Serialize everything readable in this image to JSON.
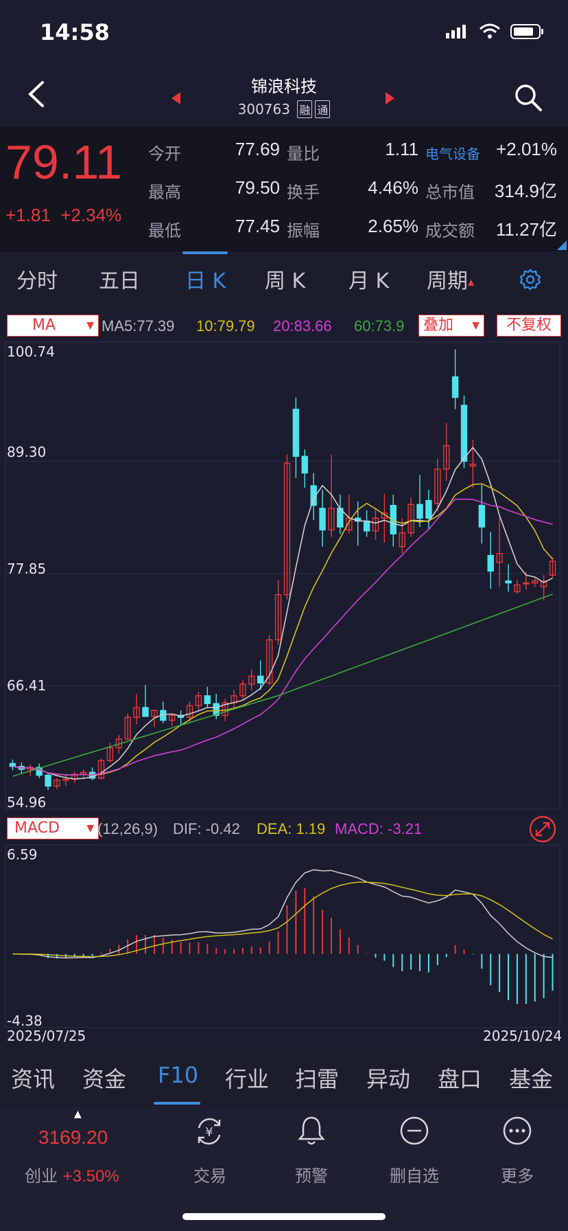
{
  "status": {
    "time": "14:58"
  },
  "header": {
    "title": "锦浪科技",
    "code": "300763",
    "badge1": "融",
    "badge2": "通"
  },
  "quote": {
    "price": "79.11",
    "change": "+1.81",
    "change_pct": "+2.34%",
    "rows": [
      {
        "k1": "今开",
        "v1": "77.69",
        "k2": "量比",
        "v2": "1.11",
        "k3": "电气设备",
        "v3": "+2.01%"
      },
      {
        "k1": "最高",
        "v1": "79.50",
        "k2": "换手",
        "v2": "4.46%",
        "k3": "总市值",
        "v3": "314.9亿"
      },
      {
        "k1": "最低",
        "v1": "77.45",
        "k2": "振幅",
        "v2": "2.65%",
        "k3": "成交额",
        "v3": "11.27亿"
      }
    ]
  },
  "tabs": [
    "分时",
    "五日",
    "日 K",
    "周 K",
    "月 K",
    "周期"
  ],
  "active_tab": "日 K",
  "ma_bar": {
    "selector": "MA",
    "ma5": "MA5:77.39",
    "ma10": "10:79.79",
    "ma20": "20:83.66",
    "ma60": "60:73.9",
    "overlay": "叠加",
    "adjust": "不复权"
  },
  "price_axis": [
    "100.74",
    "89.30",
    "77.85",
    "66.41",
    "54.96"
  ],
  "macd_bar": {
    "selector": "MACD",
    "params": "(12,26,9)",
    "dif": "DIF: -0.42",
    "dea": "DEA: 1.19",
    "macd": "MACD: -3.21"
  },
  "macd_axis": [
    "6.59",
    "-4.38"
  ],
  "dates": {
    "start": "2025/07/25",
    "end": "2025/10/24"
  },
  "bottom_tabs": [
    "资讯",
    "资金",
    "F10",
    "行业",
    "扫雷",
    "异动",
    "盘口",
    "基金"
  ],
  "active_bottom_tab": "F10",
  "nav": {
    "index_value": "3169.20",
    "index_name": "创业",
    "index_pct": "+3.50%",
    "items": [
      {
        "label": "交易",
        "icon": "yen-exchange-icon"
      },
      {
        "label": "预警",
        "icon": "bell-icon"
      },
      {
        "label": "删自选",
        "icon": "minus-circle-icon"
      },
      {
        "label": "更多",
        "icon": "more-dots-icon"
      }
    ]
  },
  "colors": {
    "up": "#e8383d",
    "down": "#4fe3ee",
    "ma5": "#cfcfcf",
    "ma10": "#d4c21a",
    "ma20": "#d43fd4",
    "ma60": "#3ea83e",
    "accent": "#3f8ae0"
  },
  "chart_data": {
    "type": "candlestick",
    "ylim": [
      54.96,
      100.74
    ],
    "x_range": [
      "2025/07/25",
      "2025/10/24"
    ],
    "candles": [
      [
        58.5,
        58.9,
        57.8,
        58.2
      ],
      [
        58.2,
        58.6,
        57.5,
        57.9
      ],
      [
        57.9,
        58.4,
        57.2,
        58.1
      ],
      [
        58.1,
        58.5,
        57.0,
        57.3
      ],
      [
        57.3,
        57.6,
        55.8,
        56.2
      ],
      [
        56.2,
        57.0,
        55.9,
        56.8
      ],
      [
        56.8,
        57.3,
        56.2,
        56.9
      ],
      [
        56.9,
        57.7,
        56.5,
        57.4
      ],
      [
        57.4,
        57.9,
        56.9,
        57.6
      ],
      [
        57.6,
        58.1,
        56.8,
        57.0
      ],
      [
        57.0,
        59.0,
        56.9,
        58.8
      ],
      [
        58.8,
        60.6,
        58.6,
        60.1
      ],
      [
        60.1,
        61.4,
        59.5,
        61.0
      ],
      [
        61.0,
        63.6,
        60.9,
        63.2
      ],
      [
        63.2,
        65.6,
        62.5,
        64.2
      ],
      [
        64.2,
        66.5,
        63.6,
        63.3
      ],
      [
        63.3,
        64.0,
        62.2,
        63.9
      ],
      [
        63.9,
        64.8,
        62.6,
        62.9
      ],
      [
        62.9,
        63.6,
        62.3,
        63.4
      ],
      [
        63.4,
        63.9,
        62.4,
        63.2
      ],
      [
        63.2,
        64.8,
        62.6,
        64.4
      ],
      [
        64.4,
        65.8,
        63.9,
        65.4
      ],
      [
        65.4,
        66.3,
        64.2,
        64.6
      ],
      [
        64.6,
        65.6,
        63.0,
        63.4
      ],
      [
        63.4,
        65.1,
        62.8,
        64.7
      ],
      [
        64.7,
        66.0,
        64.1,
        65.4
      ],
      [
        65.4,
        67.0,
        64.9,
        66.6
      ],
      [
        66.6,
        68.1,
        65.9,
        67.4
      ],
      [
        67.4,
        69.0,
        66.0,
        66.7
      ],
      [
        66.7,
        71.6,
        66.5,
        71.1
      ],
      [
        71.1,
        77.2,
        70.6,
        75.7
      ],
      [
        75.7,
        90.0,
        75.2,
        89.1
      ],
      [
        94.6,
        95.8,
        87.6,
        89.8
      ],
      [
        89.8,
        90.5,
        86.6,
        88.1
      ],
      [
        86.8,
        88.1,
        83.3,
        84.8
      ],
      [
        84.5,
        86.4,
        80.6,
        82.3
      ],
      [
        82.3,
        90.0,
        81.6,
        84.5
      ],
      [
        84.5,
        85.9,
        81.9,
        82.6
      ],
      [
        82.3,
        85.9,
        81.9,
        83.5
      ],
      [
        83.5,
        85.2,
        80.7,
        83.2
      ],
      [
        83.2,
        84.3,
        81.6,
        82.2
      ],
      [
        82.2,
        84.5,
        81.3,
        83.5
      ],
      [
        83.5,
        86.0,
        81.0,
        84.0
      ],
      [
        84.8,
        85.9,
        80.6,
        81.9
      ],
      [
        80.6,
        83.5,
        79.9,
        82.0
      ],
      [
        82.0,
        85.6,
        81.6,
        84.9
      ],
      [
        84.9,
        87.9,
        82.6,
        83.5
      ],
      [
        85.3,
        86.4,
        82.4,
        83.5
      ],
      [
        85.0,
        89.6,
        84.2,
        88.5
      ],
      [
        88.5,
        93.2,
        87.3,
        90.9
      ],
      [
        97.9,
        100.7,
        94.6,
        95.8
      ],
      [
        95.0,
        96.0,
        88.6,
        89.3
      ],
      [
        88.8,
        91.5,
        86.6,
        89.0
      ],
      [
        84.8,
        86.9,
        80.9,
        82.6
      ],
      [
        79.7,
        82.1,
        76.3,
        78.1
      ],
      [
        79.0,
        83.6,
        76.5,
        79.9
      ],
      [
        77.1,
        78.8,
        76.0,
        76.9
      ],
      [
        76.0,
        77.2,
        75.8,
        76.7
      ],
      [
        76.8,
        78.0,
        76.2,
        76.9
      ],
      [
        76.9,
        77.4,
        76.5,
        77.1
      ],
      [
        76.5,
        77.7,
        75.1,
        77.1
      ],
      [
        77.69,
        79.5,
        77.45,
        79.11
      ]
    ],
    "series": [
      {
        "name": "MA5",
        "value": 77.39
      },
      {
        "name": "MA10",
        "value": 79.79
      },
      {
        "name": "MA20",
        "value": 83.66
      },
      {
        "name": "MA60",
        "value": 73.9
      }
    ],
    "macd": {
      "dif": -0.42,
      "dea": 1.19,
      "macd": -3.21,
      "ylim": [
        -4.38,
        6.59
      ]
    }
  }
}
